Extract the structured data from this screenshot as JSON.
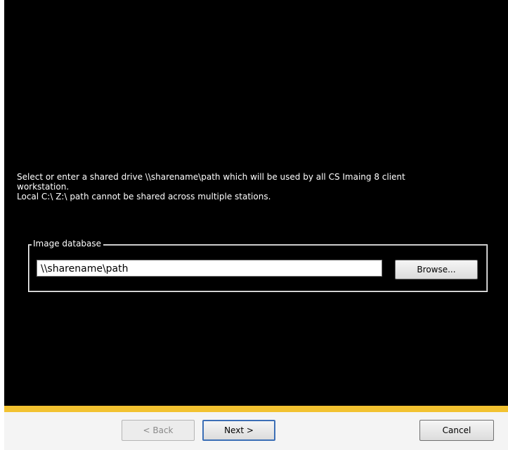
{
  "instructions": {
    "line1": "Select or enter a shared drive \\\\sharename\\path which will be used by all CS Imaing 8 client",
    "line2": "workstation.",
    "line3": "Local C:\\ Z:\\ path cannot be shared across multiple stations."
  },
  "image_database": {
    "label": "Image database",
    "path_value": "\\\\sharename\\path",
    "browse_label": "Browse..."
  },
  "footer": {
    "back_label": "< Back",
    "next_label": "Next >",
    "cancel_label": "Cancel"
  },
  "colors": {
    "panel_background": "#000000",
    "accent_line": "#f2c230",
    "footer_background": "#f4f4f4",
    "default_button_border": "#3c6fb6"
  }
}
